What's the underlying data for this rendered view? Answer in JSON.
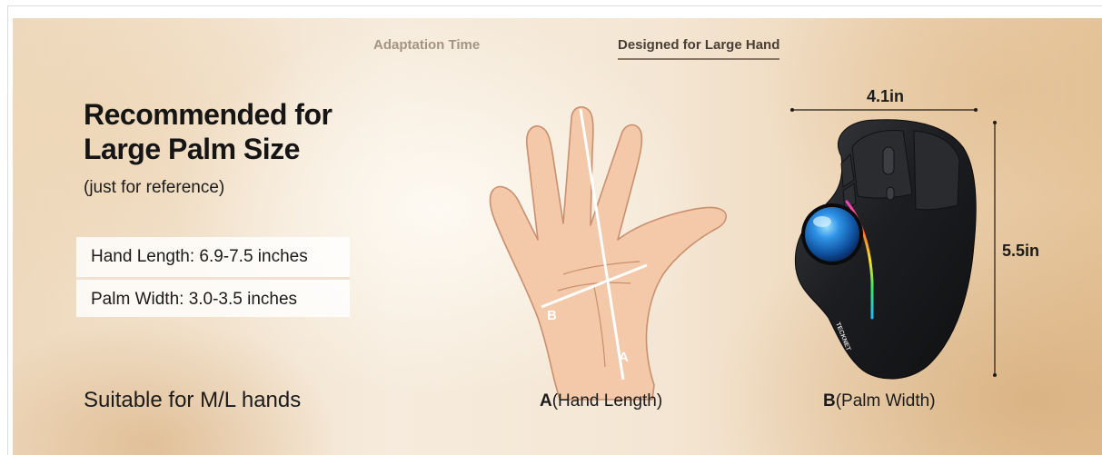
{
  "tabs": [
    {
      "label": "Adaptation Time",
      "active": false
    },
    {
      "label": "Designed for Large Hand",
      "active": true
    }
  ],
  "headline": {
    "line1": "Recommended for",
    "line2": "Large Palm Size"
  },
  "note": "(just for reference)",
  "specs": [
    {
      "text": "Hand Length: 6.9-7.5 inches"
    },
    {
      "text": "Palm Width: 3.0-3.5 inches"
    }
  ],
  "suitable": "Suitable for M/L hands",
  "hand": {
    "marker_a": "A",
    "marker_b": "B",
    "caption_letter": "A",
    "caption_text": "(Hand Length)"
  },
  "mouse": {
    "brand": "TECKNET",
    "width_label": "4.1in",
    "height_label": "5.5in",
    "caption_letter": "B",
    "caption_text": "(Palm Width)"
  },
  "colors": {
    "skin": "#f3c9a9",
    "skin_outline": "#c98f6e",
    "mouse_body": "#1e1f22",
    "trackball": "#1f7fd6"
  }
}
